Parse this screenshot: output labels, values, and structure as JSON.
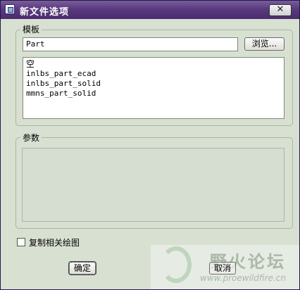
{
  "window": {
    "title": "新文件选项",
    "close_glyph": "✕"
  },
  "template_group": {
    "label": "模板",
    "name_value": "Part",
    "browse_label": "浏览...",
    "items": [
      "空",
      "inlbs_part_ecad",
      "inlbs_part_solid",
      "mmns_part_solid"
    ]
  },
  "params_group": {
    "label": "参数"
  },
  "copy_related_drawing": {
    "label": "复制相关绘图",
    "checked": false
  },
  "buttons": {
    "ok": "确定",
    "cancel": "取消"
  },
  "watermark": {
    "title": "野火论坛",
    "url": "www.proewildfire.cn"
  },
  "icons": [
    "app-icon",
    "close-icon"
  ],
  "colors": {
    "titlebar": "#5a3a7e",
    "dialog_bg": "#d8e0d2"
  }
}
